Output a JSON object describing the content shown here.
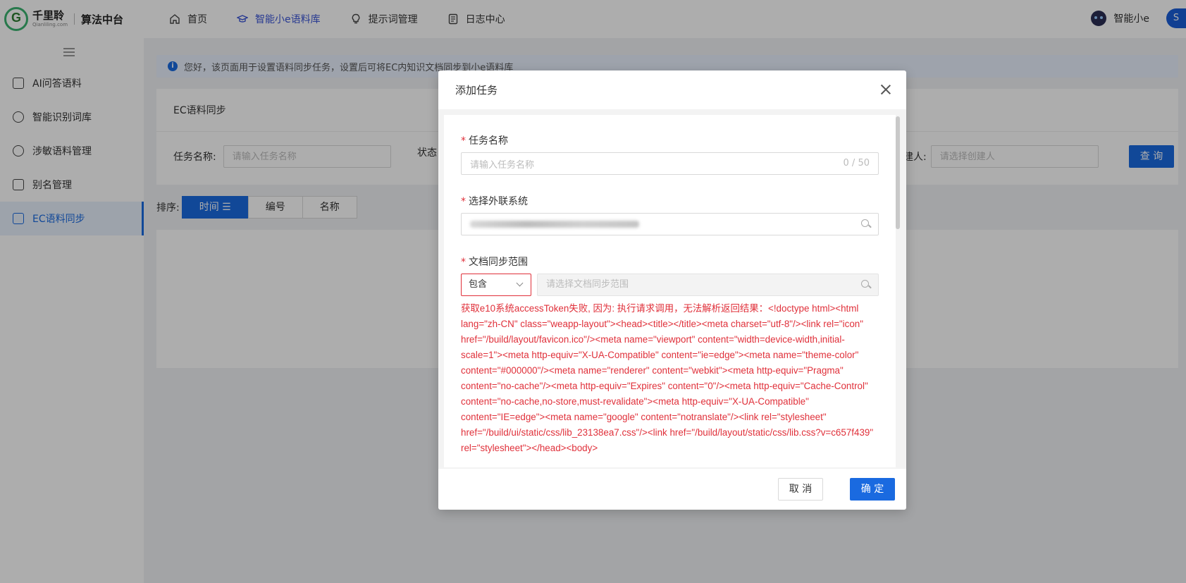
{
  "header": {
    "logo_cn": "千里聆",
    "logo_en": "Qianliling.com",
    "platform": "算法中台",
    "nav": [
      {
        "label": "首页",
        "icon": "home-icon"
      },
      {
        "label": "智能小e语料库",
        "icon": "graduation-cap-icon"
      },
      {
        "label": "提示词管理",
        "icon": "lightbulb-icon"
      },
      {
        "label": "日志中心",
        "icon": "log-icon"
      }
    ],
    "bot_name": "智能小e",
    "user_initial": "S"
  },
  "sidebar": {
    "items": [
      {
        "label": "AI问答语料",
        "icon": "qa-icon"
      },
      {
        "label": "智能识别词库",
        "icon": "dictionary-icon"
      },
      {
        "label": "涉敏语料管理",
        "icon": "ban-icon"
      },
      {
        "label": "别名管理",
        "icon": "alias-icon"
      },
      {
        "label": "EC语料同步",
        "icon": "sync-icon"
      }
    ]
  },
  "notice": {
    "text": "您好，该页面用于设置语料同步任务，设置后可将EC内知识文档同步到小e语料库"
  },
  "card": {
    "title": "EC语料同步",
    "filters": {
      "task_name_label": "任务名称:",
      "task_name_placeholder": "请输入任务名称",
      "status_label": "状态",
      "creator_label": "建人:",
      "creator_placeholder": "请选择创建人"
    },
    "search_button": "查 询"
  },
  "sort": {
    "label": "排序:",
    "options": [
      "时间 ☰",
      "编号",
      "名称"
    ]
  },
  "modal": {
    "title": "添加任务",
    "fields": {
      "task_name": {
        "label": "任务名称",
        "placeholder": "请输入任务名称",
        "counter": "0 / 50"
      },
      "external_system": {
        "label": "选择外联系统"
      },
      "sync_range": {
        "label": "文档同步范围",
        "mode": "包含",
        "placeholder": "请选择文档同步范围"
      }
    },
    "error": "获取e10系统accessToken失败, 因为: 执行请求调用，无法解析返回结果：<!doctype html><html lang=\"zh-CN\" class=\"weapp-layout\"><head><title></title><meta charset=\"utf-8\"/><link rel=\"icon\" href=\"/build/layout/favicon.ico\"/><meta name=\"viewport\" content=\"width=device-width,initial-scale=1\"><meta http-equiv=\"X-UA-Compatible\" content=\"ie=edge\"><meta name=\"theme-color\" content=\"#000000\"/><meta name=\"renderer\" content=\"webkit\"><meta http-equiv=\"Pragma\" content=\"no-cache\"/><meta http-equiv=\"Expires\" content=\"0\"/><meta http-equiv=\"Cache-Control\" content=\"no-cache,no-store,must-revalidate\"><meta http-equiv=\"X-UA-Compatible\" content=\"IE=edge\"><meta name=\"google\" content=\"notranslate\"/><link rel=\"stylesheet\" href=\"/build/ui/static/css/lib_23138ea7.css\"/><link href=\"/build/layout/static/css/lib.css?v=c657f439\" rel=\"stylesheet\"></head><body>",
    "cancel": "取 消",
    "ok": "确 定"
  },
  "colors": {
    "primary": "#1a6ae0",
    "error": "#e0303a",
    "nav_active": "#3a55d6"
  }
}
